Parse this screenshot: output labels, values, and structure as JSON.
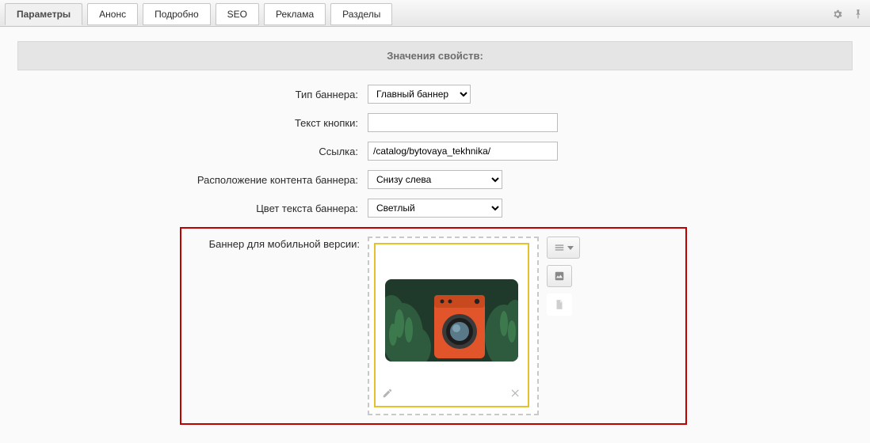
{
  "tabs": {
    "parameters": "Параметры",
    "announce": "Анонс",
    "detail": "Подробно",
    "seo": "SEO",
    "ad": "Реклама",
    "sections": "Разделы"
  },
  "section_heading": "Значения свойств:",
  "fields": {
    "banner_type_label": "Тип баннера:",
    "banner_type_value": "Главный баннер",
    "button_text_label": "Текст кнопки:",
    "button_text_value": "",
    "link_label": "Ссылка:",
    "link_value": "/catalog/bytovaya_tekhnika/",
    "content_pos_label": "Расположение контента баннера:",
    "content_pos_value": "Снизу слева",
    "text_color_label": "Цвет текста баннера:",
    "text_color_value": "Светлый",
    "mobile_banner_label": "Баннер для мобильной версии:"
  },
  "icons": {
    "gear": "gear-icon",
    "pin": "pin-icon",
    "pencil": "pencil-icon",
    "close": "close-icon",
    "menu": "menu-icon",
    "image": "image-icon",
    "file": "file-icon"
  }
}
